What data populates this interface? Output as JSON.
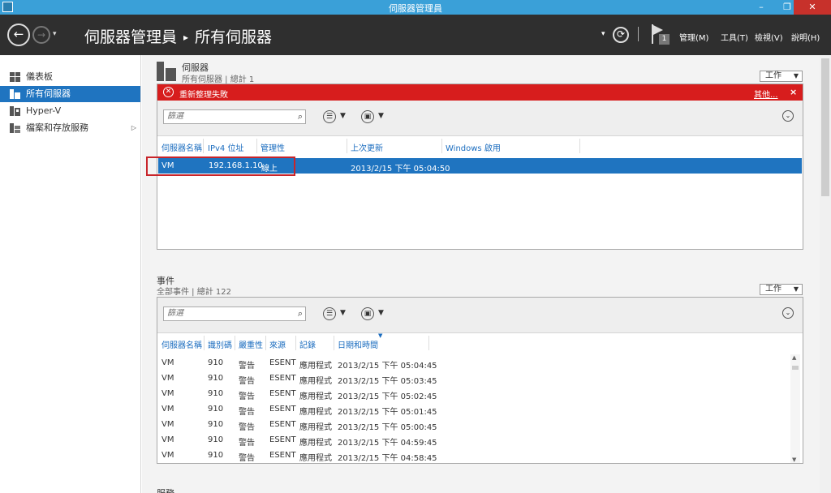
{
  "window": {
    "title": "伺服器管理員",
    "minimize": "–",
    "restore": "❐",
    "close": "✕"
  },
  "header": {
    "back": "←",
    "forward": "→",
    "nav_caret": "▾",
    "breadcrumb_root": "伺服器管理員",
    "breadcrumb_sep": "▸",
    "breadcrumb_current": "所有伺服器",
    "refresh_caret": "▾",
    "refresh_icon": "⟳",
    "notification_count": "1",
    "menus": [
      "管理(M)",
      "工具(T)",
      "檢視(V)",
      "說明(H)"
    ]
  },
  "sidebar": {
    "items": [
      {
        "label": "儀表板",
        "icon": "dashboard-icon",
        "active": false
      },
      {
        "label": "所有伺服器",
        "icon": "servers-icon",
        "active": true
      },
      {
        "label": "Hyper-V",
        "icon": "hyperv-icon",
        "active": false
      },
      {
        "label": "檔案和存放服務",
        "icon": "file-storage-icon",
        "active": false,
        "has_children": true,
        "arrow": "▷"
      }
    ]
  },
  "servers": {
    "title": "伺服器",
    "subtitle": "所有伺服器 | 總計 1",
    "tasks_label": "工作",
    "tasks_caret": "▼",
    "error": {
      "icon": "✕",
      "message": "重新整理失敗",
      "more": "其他...",
      "dismiss": "×"
    },
    "filter_placeholder": "篩選",
    "search_icon": "⌕",
    "list_icon": "☰",
    "save_icon": "▣",
    "caret": "▼",
    "expand_icon": "⌄",
    "columns": [
      "伺服器名稱",
      "IPv4 位址",
      "管理性",
      "上次更新",
      "Windows 啟用"
    ],
    "rows": [
      {
        "name": "VM",
        "ipv4": "192.168.1.10",
        "manageability": "線上",
        "last_update": "2013/2/15 下午 05:04:50",
        "activation": ""
      }
    ]
  },
  "events": {
    "title": "事件",
    "subtitle": "全部事件 | 總計 122",
    "tasks_label": "工作",
    "tasks_caret": "▼",
    "filter_placeholder": "篩選",
    "search_icon": "⌕",
    "list_icon": "☰",
    "save_icon": "▣",
    "caret": "▼",
    "expand_icon": "⌄",
    "sort_indicator": "▼",
    "scroll_up": "▲",
    "scroll_down": "▼",
    "columns": [
      "伺服器名稱",
      "識別碼",
      "嚴重性",
      "來源",
      "記錄",
      "日期和時間"
    ],
    "rows": [
      {
        "server": "VM",
        "id": "910",
        "severity": "警告",
        "source": "ESENT",
        "log": "應用程式",
        "datetime": "2013/2/15 下午 05:04:45"
      },
      {
        "server": "VM",
        "id": "910",
        "severity": "警告",
        "source": "ESENT",
        "log": "應用程式",
        "datetime": "2013/2/15 下午 05:03:45"
      },
      {
        "server": "VM",
        "id": "910",
        "severity": "警告",
        "source": "ESENT",
        "log": "應用程式",
        "datetime": "2013/2/15 下午 05:02:45"
      },
      {
        "server": "VM",
        "id": "910",
        "severity": "警告",
        "source": "ESENT",
        "log": "應用程式",
        "datetime": "2013/2/15 下午 05:01:45"
      },
      {
        "server": "VM",
        "id": "910",
        "severity": "警告",
        "source": "ESENT",
        "log": "應用程式",
        "datetime": "2013/2/15 下午 05:00:45"
      },
      {
        "server": "VM",
        "id": "910",
        "severity": "警告",
        "source": "ESENT",
        "log": "應用程式",
        "datetime": "2013/2/15 下午 04:59:45"
      },
      {
        "server": "VM",
        "id": "910",
        "severity": "警告",
        "source": "ESENT",
        "log": "應用程式",
        "datetime": "2013/2/15 下午 04:58:45"
      }
    ]
  },
  "services": {
    "title": "服務"
  },
  "colors": {
    "title_bar": "#3aa0d8",
    "header": "#2f2f2f",
    "selection": "#1f74c0",
    "error": "#d71d1d",
    "highlight_box": "#c8242a"
  }
}
